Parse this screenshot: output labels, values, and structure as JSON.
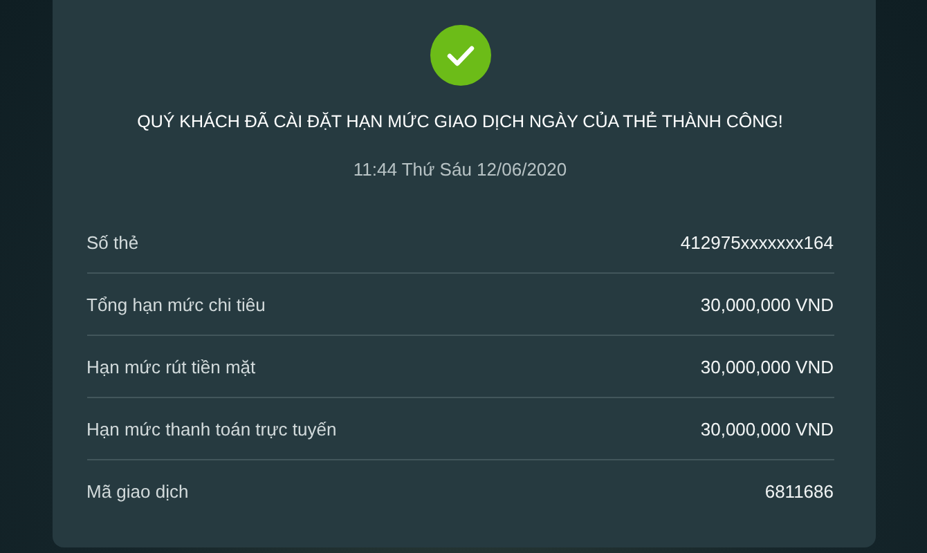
{
  "result": {
    "title": "QUÝ KHÁCH ĐÃ CÀI ĐẶT HẠN MỨC GIAO DỊCH NGÀY CỦA THẺ THÀNH CÔNG!",
    "datetime": "11:44 Thứ Sáu 12/06/2020"
  },
  "details": [
    {
      "label": "Số thẻ",
      "value": "412975xxxxxxx164"
    },
    {
      "label": "Tổng hạn mức chi tiêu",
      "value": "30,000,000 VND"
    },
    {
      "label": "Hạn mức rút tiền mặt",
      "value": "30,000,000 VND"
    },
    {
      "label": "Hạn mức thanh toán trực tuyến",
      "value": "30,000,000 VND"
    },
    {
      "label": "Mã giao dịch",
      "value": "6811686"
    }
  ]
}
